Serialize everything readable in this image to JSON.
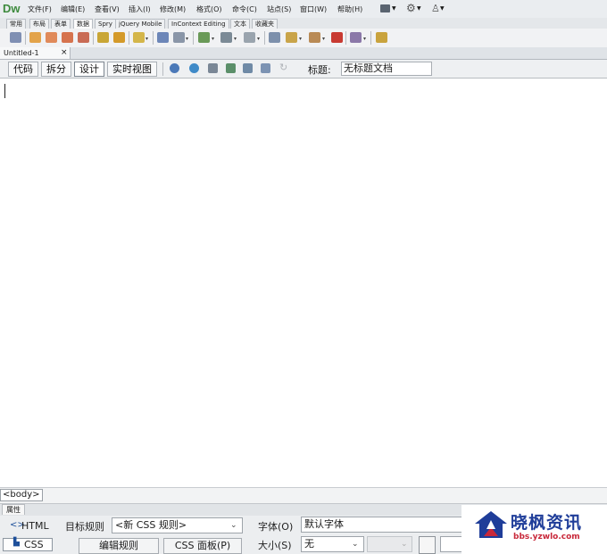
{
  "app": {
    "logo": "Dw"
  },
  "menus": [
    {
      "label": "文件(F)"
    },
    {
      "label": "编辑(E)"
    },
    {
      "label": "查看(V)"
    },
    {
      "label": "插入(I)"
    },
    {
      "label": "修改(M)"
    },
    {
      "label": "格式(O)"
    },
    {
      "label": "命令(C)"
    },
    {
      "label": "站点(S)"
    },
    {
      "label": "窗口(W)"
    },
    {
      "label": "帮助(H)"
    }
  ],
  "insert_tabs": [
    {
      "label": "常用"
    },
    {
      "label": "布局"
    },
    {
      "label": "表单"
    },
    {
      "label": "数据"
    },
    {
      "label": "Spry"
    },
    {
      "label": "jQuery Mobile"
    },
    {
      "label": "InContext Editing"
    },
    {
      "label": "文本"
    },
    {
      "label": "收藏夹"
    }
  ],
  "active_insert_tab": "数据",
  "document": {
    "tab_label": "Untitled-1",
    "close_glyph": "×"
  },
  "view_buttons": [
    {
      "label": "代码"
    },
    {
      "label": "拆分"
    },
    {
      "label": "设计"
    },
    {
      "label": "实时视图"
    }
  ],
  "active_view": "设计",
  "title_field": {
    "label": "标题:",
    "value": "无标题文档"
  },
  "status": {
    "tag": "<body>"
  },
  "properties": {
    "panel_tab": "属性",
    "html_button": "HTML",
    "css_button": "CSS",
    "target_rule_label": "目标规则",
    "target_rule_value": "<新 CSS 规则>",
    "edit_rule_button": "编辑规则",
    "css_panel_button": "CSS 面板(P)",
    "font_label": "字体(O)",
    "font_value": "默认字体",
    "size_label": "大小(S)",
    "size_value": "无"
  },
  "watermark": {
    "name": "晓枫资讯",
    "url": "bbs.yzwlo.com"
  },
  "colors": {
    "logo_green": "#3d8a3d",
    "watermark_blue": "#1f3d99",
    "watermark_red": "#c8283a"
  }
}
